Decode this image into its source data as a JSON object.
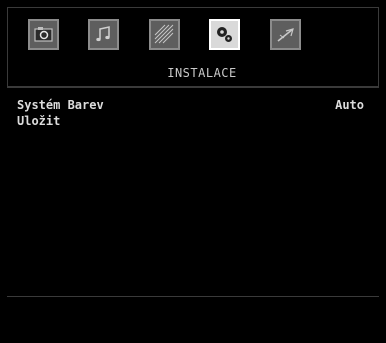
{
  "menu": {
    "tabs": [
      {
        "icon": "picture-icon",
        "active": false
      },
      {
        "icon": "sound-icon",
        "active": false
      },
      {
        "icon": "settings-icon",
        "active": false
      },
      {
        "icon": "install-icon",
        "active": true
      },
      {
        "icon": "source-icon",
        "active": false
      }
    ],
    "title": "INSTALACE",
    "items": [
      {
        "label": "Systém Barev",
        "value": "Auto"
      },
      {
        "label": "Uložit",
        "value": ""
      }
    ]
  },
  "colors": {
    "background": "#000000",
    "tab_inactive": "#5e5e5e",
    "tab_active": "#d9d9d9",
    "text": "#dcdcdc"
  }
}
